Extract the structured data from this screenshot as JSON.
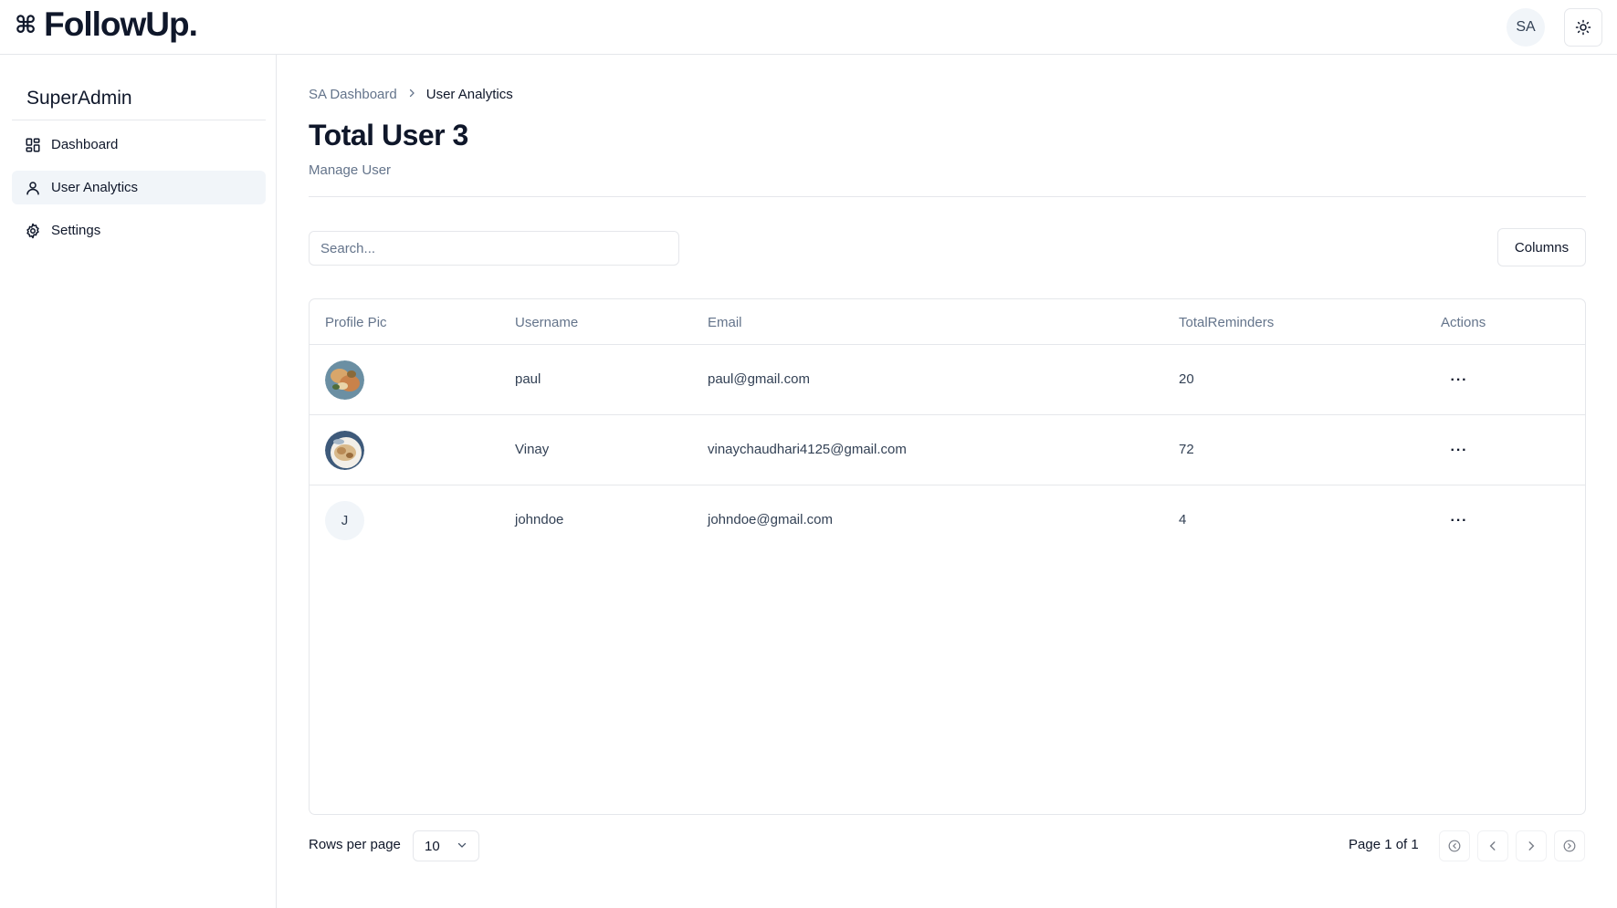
{
  "header": {
    "brand_mark": "⌘",
    "brand_name": "FollowUp.",
    "avatar_initials": "SA",
    "theme_icon": "sun-icon"
  },
  "sidebar": {
    "title": "SuperAdmin",
    "items": [
      {
        "label": "Dashboard",
        "icon": "dashboard-icon",
        "active": false
      },
      {
        "label": "User Analytics",
        "icon": "user-icon",
        "active": true
      },
      {
        "label": "Settings",
        "icon": "gear-icon",
        "active": false
      }
    ]
  },
  "breadcrumb": {
    "parent": "SA Dashboard",
    "current": "User Analytics"
  },
  "page": {
    "title": "Total User 3",
    "subtitle": "Manage User"
  },
  "toolbar": {
    "search_placeholder": "Search...",
    "search_value": "",
    "columns_label": "Columns"
  },
  "table": {
    "headers": [
      "Profile Pic",
      "Username",
      "Email",
      "TotalReminders",
      "Actions"
    ],
    "rows": [
      {
        "pic": "photo",
        "initial": "",
        "username": "paul",
        "email": "paul@gmail.com",
        "total_reminders": "20"
      },
      {
        "pic": "photo",
        "initial": "",
        "username": "Vinay",
        "email": "vinaychaudhari4125@gmail.com",
        "total_reminders": "72"
      },
      {
        "pic": "initial",
        "initial": "J",
        "username": "johndoe",
        "email": "johndoe@gmail.com",
        "total_reminders": "4"
      }
    ],
    "actions_glyph": "···"
  },
  "pagination": {
    "rows_per_page_label": "Rows per page",
    "rows_per_page_value": "10",
    "page_info": "Page 1 of 1"
  },
  "colors": {
    "border": "#e5e7eb",
    "muted_text": "#64748b",
    "active_bg": "#f1f5f9"
  }
}
